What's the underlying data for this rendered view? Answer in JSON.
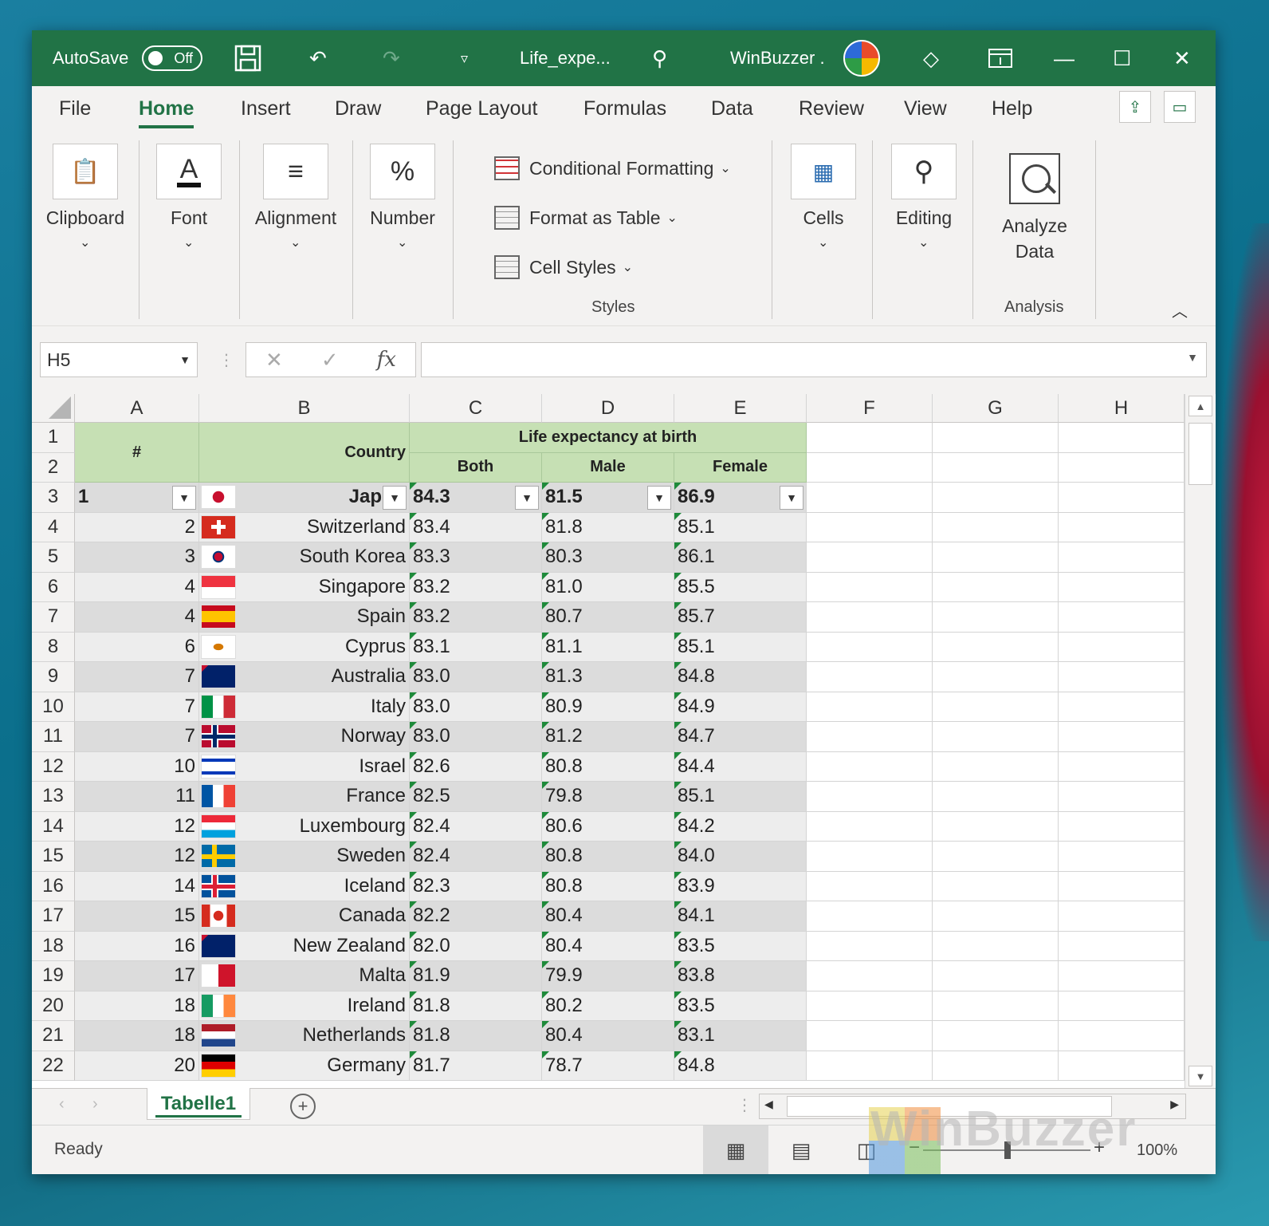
{
  "titlebar": {
    "autosave_label": "AutoSave",
    "autosave_state": "Off",
    "filename": "Life_expe...",
    "user_name": "WinBuzzer ."
  },
  "tabs": [
    "File",
    "Home",
    "Insert",
    "Draw",
    "Page Layout",
    "Formulas",
    "Data",
    "Review",
    "View",
    "Help"
  ],
  "active_tab": "Home",
  "ribbon": {
    "clipboard": "Clipboard",
    "font": "Font",
    "alignment": "Alignment",
    "number": "Number",
    "conditional_formatting": "Conditional Formatting",
    "format_as_table": "Format as Table",
    "cell_styles": "Cell Styles",
    "styles_caption": "Styles",
    "cells": "Cells",
    "editing": "Editing",
    "analyze_line1": "Analyze",
    "analyze_line2": "Data",
    "analysis_caption": "Analysis"
  },
  "formula_bar": {
    "name_box": "H5",
    "fx": "fx",
    "value": ""
  },
  "columns": [
    "A",
    "B",
    "C",
    "D",
    "E",
    "F",
    "G",
    "H"
  ],
  "headers": {
    "rank": "#",
    "country": "Country",
    "group": "Life expectancy at birth",
    "both": "Both",
    "male": "Male",
    "female": "Female"
  },
  "rows": [
    {
      "row": "1",
      "rank": "",
      "country": "",
      "both": "",
      "male": "",
      "female": ""
    },
    {
      "row": "2",
      "rank": "",
      "country": "",
      "both": "",
      "male": "",
      "female": ""
    },
    {
      "row": "3",
      "rank": "1",
      "country": "Jap",
      "both": "84.3",
      "male": "81.5",
      "female": "86.9"
    },
    {
      "row": "4",
      "rank": "2",
      "country": "Switzerland",
      "both": "83.4",
      "male": "81.8",
      "female": "85.1"
    },
    {
      "row": "5",
      "rank": "3",
      "country": "South Korea",
      "both": "83.3",
      "male": "80.3",
      "female": "86.1"
    },
    {
      "row": "6",
      "rank": "4",
      "country": "Singapore",
      "both": "83.2",
      "male": "81.0",
      "female": "85.5"
    },
    {
      "row": "7",
      "rank": "4",
      "country": "Spain",
      "both": "83.2",
      "male": "80.7",
      "female": "85.7"
    },
    {
      "row": "8",
      "rank": "6",
      "country": "Cyprus",
      "both": "83.1",
      "male": "81.1",
      "female": "85.1"
    },
    {
      "row": "9",
      "rank": "7",
      "country": "Australia",
      "both": "83.0",
      "male": "81.3",
      "female": "84.8"
    },
    {
      "row": "10",
      "rank": "7",
      "country": "Italy",
      "both": "83.0",
      "male": "80.9",
      "female": "84.9"
    },
    {
      "row": "11",
      "rank": "7",
      "country": "Norway",
      "both": "83.0",
      "male": "81.2",
      "female": "84.7"
    },
    {
      "row": "12",
      "rank": "10",
      "country": "Israel",
      "both": "82.6",
      "male": "80.8",
      "female": "84.4"
    },
    {
      "row": "13",
      "rank": "11",
      "country": "France",
      "both": "82.5",
      "male": "79.8",
      "female": "85.1"
    },
    {
      "row": "14",
      "rank": "12",
      "country": "Luxembourg",
      "both": "82.4",
      "male": "80.6",
      "female": "84.2"
    },
    {
      "row": "15",
      "rank": "12",
      "country": "Sweden",
      "both": "82.4",
      "male": "80.8",
      "female": "84.0"
    },
    {
      "row": "16",
      "rank": "14",
      "country": "Iceland",
      "both": "82.3",
      "male": "80.8",
      "female": "83.9"
    },
    {
      "row": "17",
      "rank": "15",
      "country": "Canada",
      "both": "82.2",
      "male": "80.4",
      "female": "84.1"
    },
    {
      "row": "18",
      "rank": "16",
      "country": "New Zealand",
      "both": "82.0",
      "male": "80.4",
      "female": "83.5"
    },
    {
      "row": "19",
      "rank": "17",
      "country": "Malta",
      "both": "81.9",
      "male": "79.9",
      "female": "83.8"
    },
    {
      "row": "20",
      "rank": "18",
      "country": "Ireland",
      "both": "81.8",
      "male": "80.2",
      "female": "83.5"
    },
    {
      "row": "21",
      "rank": "18",
      "country": "Netherlands",
      "both": "81.8",
      "male": "80.4",
      "female": "83.1"
    },
    {
      "row": "22",
      "rank": "20",
      "country": "Germany",
      "both": "81.7",
      "male": "78.7",
      "female": "84.8"
    }
  ],
  "flags": [
    "japan-flag-icon",
    "switzerland-flag-icon",
    "south-korea-flag-icon",
    "singapore-flag-icon",
    "spain-flag-icon",
    "cyprus-flag-icon",
    "australia-flag-icon",
    "italy-flag-icon",
    "norway-flag-icon",
    "israel-flag-icon",
    "france-flag-icon",
    "luxembourg-flag-icon",
    "sweden-flag-icon",
    "iceland-flag-icon",
    "canada-flag-icon",
    "new-zealand-flag-icon",
    "malta-flag-icon",
    "ireland-flag-icon",
    "netherlands-flag-icon",
    "germany-flag-icon"
  ],
  "sheet_tab": "Tabelle1",
  "status": {
    "ready": "Ready",
    "zoom": "100%"
  },
  "watermark": "WinBuzzer",
  "colors": {
    "excel_green": "#217346",
    "header_fill": "#c6e0b4",
    "band_light": "#ededed",
    "band_dark": "#dcdcdc"
  }
}
